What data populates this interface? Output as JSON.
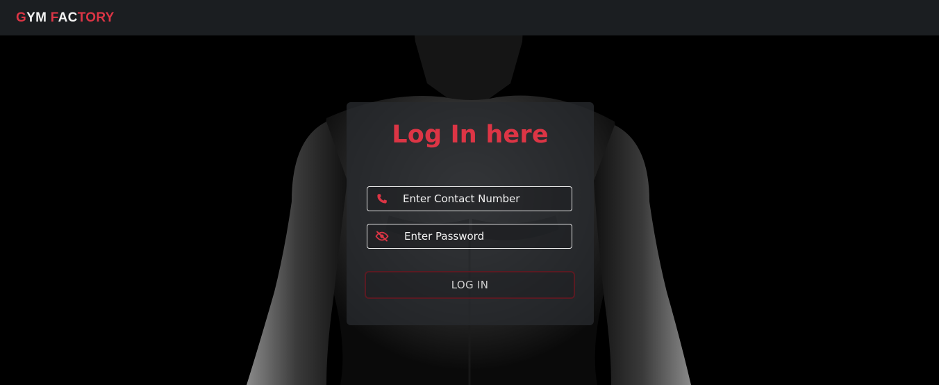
{
  "navbar": {
    "brand": {
      "g": "G",
      "ym": "YM",
      "f": "F",
      "ac": "AC",
      "tory": "TORY"
    }
  },
  "login": {
    "title": "Log In here",
    "contact": {
      "placeholder": "Enter Contact Number",
      "icon": "phone-icon"
    },
    "password": {
      "placeholder": "Enter Password",
      "icon": "eye-slash-icon"
    },
    "button_label": "LOG IN"
  },
  "colors": {
    "accent": "#dc3545",
    "navbar_bg": "#1b1e21",
    "card_bg": "#2a2c30"
  }
}
